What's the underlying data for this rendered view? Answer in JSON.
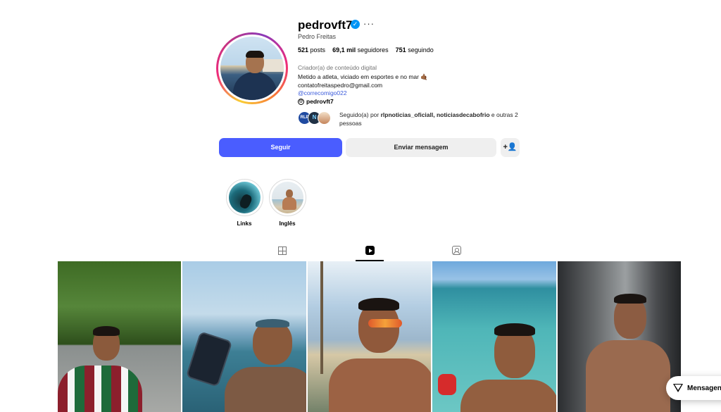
{
  "profile": {
    "username": "pedrovft7",
    "full_name": "Pedro Freitas",
    "verified_icon": "verified-check-icon",
    "stats": {
      "posts_count": "521",
      "posts_label": "posts",
      "followers_count": "69,1 mil",
      "followers_label": "seguidores",
      "following_count": "751",
      "following_label": "seguindo"
    },
    "category": "Criador(a) de conteúdo digital",
    "bio_line1": "Metido a atleta, viciado em esportes e no mar 🤙🏾",
    "bio_line2": "contatofreitaspedro@gmail.com",
    "bio_link": "@correcomigo022",
    "threads_handle": "pedrovft7",
    "followed_by_prefix": "Seguido(a) por",
    "followed_by_users": "rlpnoticias_oficiall, noticiasdecabofrio",
    "followed_by_suffix": "e outras 2 pessoas",
    "followed_avatar_1": "RLP",
    "followed_avatar_2": "N"
  },
  "actions": {
    "follow_label": "Seguir",
    "message_label": "Enviar mensagem",
    "suggest_icon": "add-person-icon",
    "suggest_glyph": "+👤"
  },
  "highlights": [
    {
      "label": "Links"
    },
    {
      "label": "Inglês"
    }
  ],
  "tabs": {
    "active": "reels",
    "items": [
      "grid-icon",
      "reels-icon",
      "tagged-icon"
    ]
  },
  "messages": {
    "label": "Mensagens",
    "icon": "send-icon"
  },
  "colors": {
    "follow_button": "#4a5dff",
    "secondary_button": "#efefef",
    "verified": "#0095f6",
    "link": "#3b5bdb"
  }
}
